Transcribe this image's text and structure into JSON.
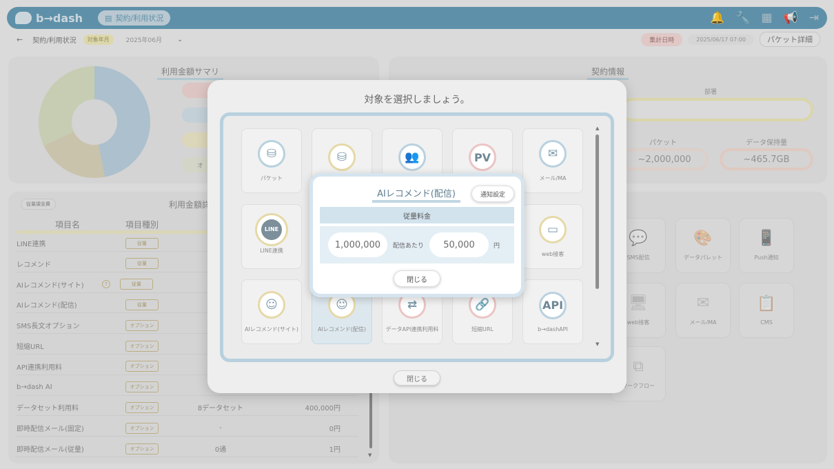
{
  "app": {
    "name": "b→dash",
    "page_pill": "契約/利用状況"
  },
  "subbar": {
    "back": "←",
    "title": "契約/利用状況",
    "target_tag": "対象年月",
    "month": "2025年06月",
    "month_chevron": "⌄",
    "tally_label": "集計日時",
    "tally_value": "2025/06/17 07:00",
    "packet_detail": "パケット詳細"
  },
  "summary": {
    "title": "利用金額サマリ",
    "partial_label": "オ"
  },
  "contract": {
    "title": "契約情報",
    "dept_label": "部署",
    "packet_label": "パケット",
    "packet_value": "~2,000,000",
    "storage_label": "データ保持量",
    "storage_value": "~465.7GB"
  },
  "usage": {
    "tag": "従量課金費",
    "title": "利用金額詳",
    "col_name": "項目名",
    "col_type": "項目種別",
    "help_glyph": "?",
    "rows": [
      {
        "name": "LINE連携",
        "type": "従量",
        "qty": "",
        "price": ""
      },
      {
        "name": "レコメンド",
        "type": "従量",
        "qty": "",
        "price": ""
      },
      {
        "name": "AIレコメンド(サイト)",
        "type": "従量",
        "qty": "",
        "price": ""
      },
      {
        "name": "AIレコメンド(配信)",
        "type": "従量",
        "qty": "",
        "price": ""
      },
      {
        "name": "SMS長文オプション",
        "type": "オプション",
        "qty": "",
        "price": ""
      },
      {
        "name": "短縮URL",
        "type": "オプション",
        "qty": "",
        "price": ""
      },
      {
        "name": "API連携利用料",
        "type": "オプション",
        "qty": "",
        "price": ""
      },
      {
        "name": "b→dash AI",
        "type": "オプション",
        "qty": "",
        "price": ""
      },
      {
        "name": "データセット利用料",
        "type": "オプション",
        "qty": "8データセット",
        "price": "400,000円"
      },
      {
        "name": "即時配信メール(固定)",
        "type": "オプション",
        "qty": "-",
        "price": "0円"
      },
      {
        "name": "即時配信メール(従量)",
        "type": "オプション",
        "qty": "0通",
        "price": "1円"
      }
    ]
  },
  "bg_cards": [
    {
      "label": "SMS配信",
      "icon": "sms-icon"
    },
    {
      "label": "データパレット",
      "icon": "palette-icon"
    },
    {
      "label": "Push通知",
      "icon": "push-icon"
    },
    {
      "label": "web接客",
      "icon": "web-icon"
    },
    {
      "label": "メール/MA",
      "icon": "mail-icon"
    },
    {
      "label": "CMS",
      "icon": "cms-icon"
    },
    {
      "label": "ワークフロー",
      "icon": "workflow-icon"
    }
  ],
  "select_modal": {
    "title": "対象を選択しましょう。",
    "close": "閉じる",
    "scroll_up": "▲",
    "scroll_down": "▼",
    "cards": [
      {
        "label": "パケット",
        "glyph": "⛁",
        "ring": "blue"
      },
      {
        "label": "",
        "glyph": "⛁",
        "ring": "yellow"
      },
      {
        "label": "",
        "glyph": "👥",
        "ring": "blue"
      },
      {
        "label": "",
        "glyph": "PV",
        "ring": "pink"
      },
      {
        "label": "メール/MA",
        "glyph": "✉",
        "ring": "blue"
      },
      {
        "label": "LINE連携",
        "glyph": "LINE",
        "ring": "yellow"
      },
      {
        "label": "web接客",
        "glyph": "▭",
        "ring": "yellow"
      },
      {
        "label": "AIレコメンド(サイト)",
        "glyph": "☺",
        "ring": "yellow"
      },
      {
        "label": "AIレコメンド(配信)",
        "glyph": "☺",
        "ring": "yellow"
      },
      {
        "label": "データAPI連携利用料",
        "glyph": "⇄",
        "ring": "pink"
      },
      {
        "label": "短縮URL",
        "glyph": "🔗",
        "ring": "pink"
      },
      {
        "label": "b→dashAPI",
        "glyph": "API",
        "ring": "blue"
      }
    ]
  },
  "detail_modal": {
    "title": "AIレコメンド(配信)",
    "notify_button": "通知設定",
    "fee_header": "従量料金",
    "volume": "1,000,000",
    "per_label": "配信あたり",
    "price": "50,000",
    "unit": "円",
    "close": "閉じる"
  },
  "header_icons": [
    "bell-icon",
    "wrench-icon",
    "grid-icon",
    "megaphone-icon",
    "logout-icon"
  ]
}
